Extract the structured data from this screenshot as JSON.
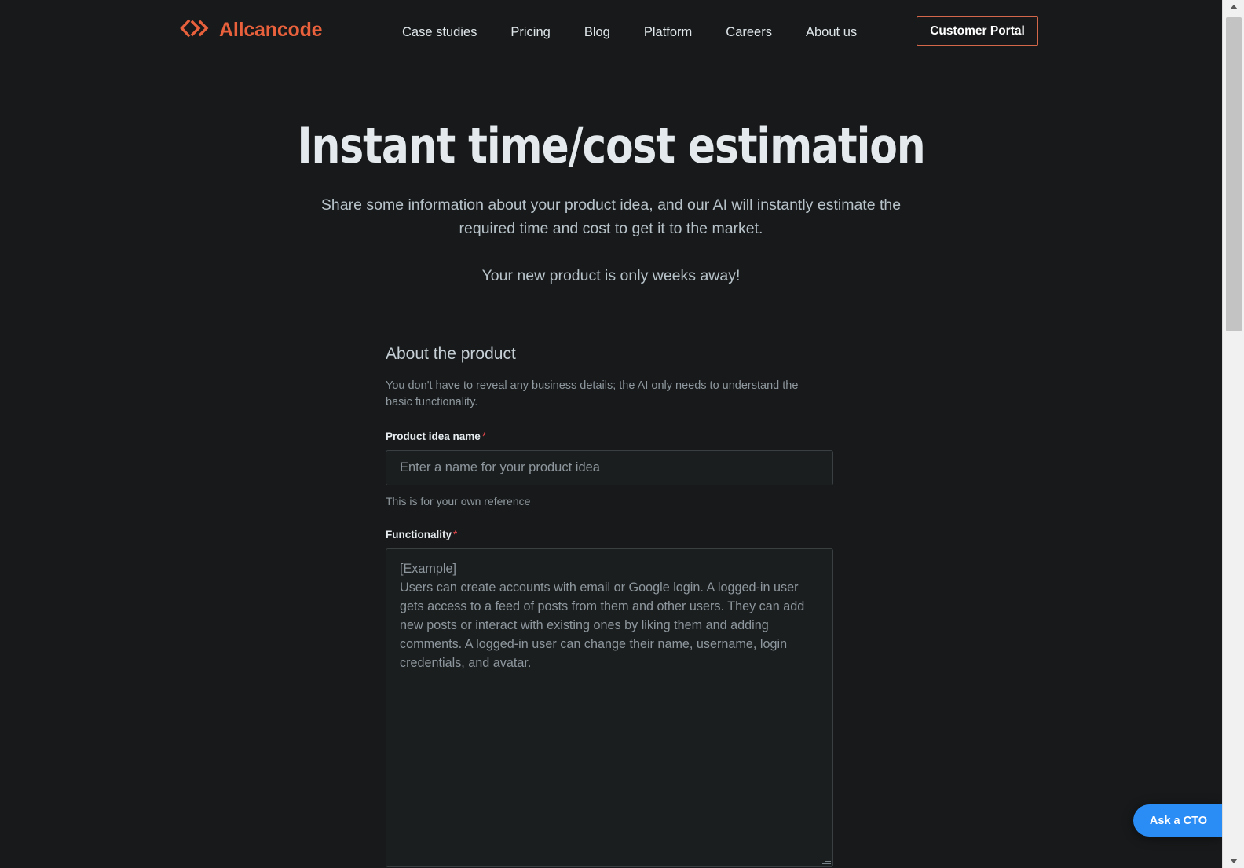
{
  "brand": {
    "name": "Allcancode",
    "mark": "chevrons-logo-icon",
    "color": "#e8613c"
  },
  "nav": {
    "items": [
      {
        "label": "Case studies"
      },
      {
        "label": "Pricing"
      },
      {
        "label": "Blog"
      },
      {
        "label": "Platform"
      },
      {
        "label": "Careers"
      },
      {
        "label": "About us"
      }
    ],
    "cta_label": "Customer Portal"
  },
  "hero": {
    "title": "Instant time/cost estimation",
    "subtitle": "Share some information about your product idea, and our AI will instantly estimate the required time and cost to get it to the market.",
    "tagline": "Your new product is only weeks away!"
  },
  "form": {
    "section_title": "About the product",
    "section_description": "You don't have to reveal any business details; the AI only needs to understand the basic functionality.",
    "fields": {
      "product_name": {
        "label": "Product idea name",
        "required_marker": "*",
        "value": "",
        "placeholder": "Enter a name for your product idea",
        "hint": "This is for your own reference"
      },
      "functionality": {
        "label": "Functionality",
        "required_marker": "*",
        "value": "",
        "placeholder": "[Example]\nUsers can create accounts with email or Google login. A logged-in user gets access to a feed of posts from them and other users. They can add new posts or interact with existing ones by liking them and adding comments. A logged-in user can change their name, username, login credentials, and avatar."
      }
    }
  },
  "chat_widget": {
    "label": "Ask a CTO",
    "color": "#2a8cf5"
  },
  "theme": {
    "background": "#17191a",
    "accent": "#e8613c",
    "required": "#e5484d",
    "text": "#c9d1d6"
  }
}
